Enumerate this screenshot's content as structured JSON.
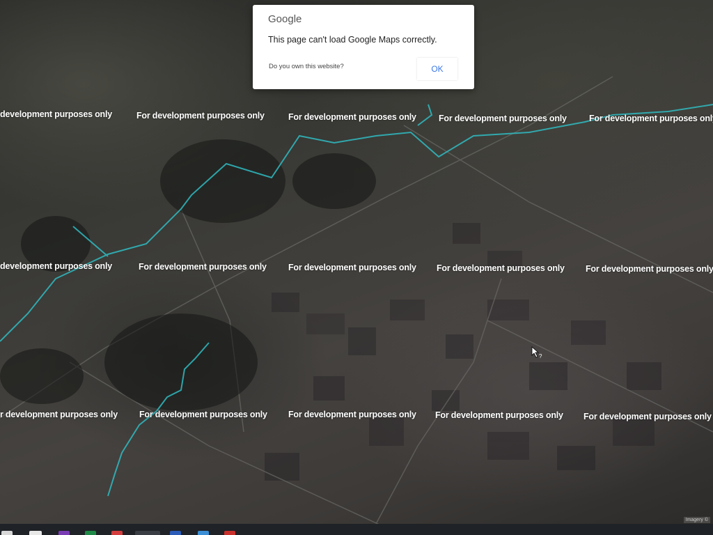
{
  "dialog": {
    "logo": "Google",
    "message": "This page can't load Google Maps correctly.",
    "question": "Do you own this website?",
    "ok_label": "OK"
  },
  "watermark": {
    "full": "For development purposes only",
    "clipped": "development purposes only",
    "clipped_alt": "r development purposes only"
  },
  "imagery_label": "Imagery ©",
  "colors": {
    "route": "#2fbcc2",
    "ok_text": "#3b78e7",
    "dialog_bg": "#ffffff"
  },
  "taskbar": {
    "icons": [
      "store-icon",
      "home-icon",
      "onenote-icon",
      "excel-icon",
      "app-icon",
      "chrome-icon",
      "word-icon",
      "globe-icon",
      "pdf-icon"
    ]
  }
}
